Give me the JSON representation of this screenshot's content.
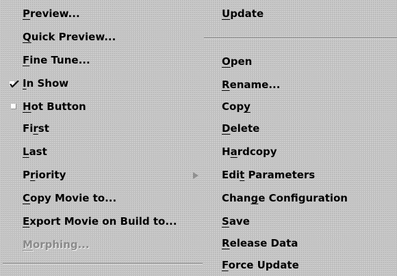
{
  "left_menu": [
    {
      "pre": "",
      "u": "P",
      "post": "review..."
    },
    {
      "pre": "",
      "u": "Q",
      "post": "uick Preview..."
    },
    {
      "pre": "",
      "u": "F",
      "post": "ine Tune..."
    },
    {
      "pre": "",
      "u": "I",
      "post": "n Show",
      "checked": true
    },
    {
      "pre": "",
      "u": "H",
      "post": "ot Button",
      "checked": false
    },
    {
      "pre": "Fi",
      "u": "r",
      "post": "st"
    },
    {
      "pre": "",
      "u": "L",
      "post": "ast"
    },
    {
      "pre": "P",
      "u": "r",
      "post": "iority",
      "submenu": true
    },
    {
      "pre": "",
      "u": "C",
      "post": "opy Movie to..."
    },
    {
      "pre": "",
      "u": "E",
      "post": "xport Movie on Build to..."
    },
    {
      "pre": "",
      "u": "M",
      "post": "orphing...",
      "disabled": true
    }
  ],
  "right_menu": [
    {
      "pre": "",
      "u": "U",
      "post": "pdate"
    },
    {
      "pre": "",
      "u": "O",
      "post": "pen"
    },
    {
      "pre": "",
      "u": "R",
      "post": "ename..."
    },
    {
      "pre": "Cop",
      "u": "y",
      "post": ""
    },
    {
      "pre": "",
      "u": "D",
      "post": "elete"
    },
    {
      "pre": "H",
      "u": "a",
      "post": "rdcopy"
    },
    {
      "pre": "Edi",
      "u": "t",
      "post": " Parameters"
    },
    {
      "pre": "Chan",
      "u": "g",
      "post": "e Configuration"
    },
    {
      "pre": "",
      "u": "S",
      "post": "ave"
    },
    {
      "pre": "",
      "u": "R",
      "post": "elease Data"
    },
    {
      "pre": "",
      "u": "F",
      "post": "orce Update"
    }
  ],
  "icons": {
    "checked": "checkmark-icon",
    "unchecked": "checkbox-empty-icon",
    "submenu": "submenu-arrow-icon"
  }
}
